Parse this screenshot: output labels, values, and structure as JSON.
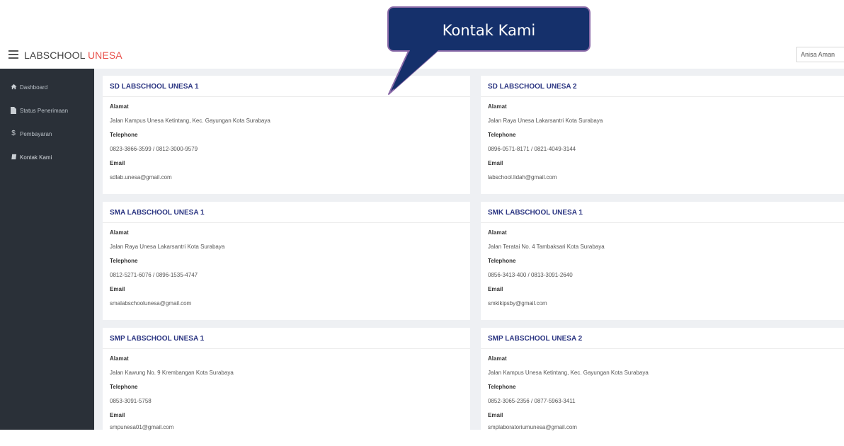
{
  "header": {
    "brand_main": "LABSCHOOL",
    "brand_accent": "UNESA",
    "user_name": "Anisa Aman"
  },
  "sidebar": {
    "items": [
      {
        "label": "Dashboard",
        "icon": "home-icon"
      },
      {
        "label": "Status Penerimaan",
        "icon": "file-icon"
      },
      {
        "label": "Pembayaran",
        "icon": "dollar-icon"
      },
      {
        "label": "Kontak Kami",
        "icon": "book-icon"
      }
    ]
  },
  "callout": {
    "text": "Kontak Kami"
  },
  "labels": {
    "address": "Alamat",
    "phone": "Telephone",
    "email": "Email"
  },
  "schools": [
    {
      "name": "SD LABSCHOOL UNESA 1",
      "address": "Jalan Kampus Unesa Ketintang, Kec. Gayungan Kota Surabaya",
      "phone": "0823-3866-3599 / 0812-3000-9579",
      "email": "sdlab.unesa@gmail.com"
    },
    {
      "name": "SD LABSCHOOL UNESA 2",
      "address": "Jalan Raya Unesa Lakarsantri Kota Surabaya",
      "phone": "0896-0571-8171 / 0821-4049-3144",
      "email": "labschool.lidah@gmail.com"
    },
    {
      "name": "SMA LABSCHOOL UNESA 1",
      "address": "Jalan Raya Unesa Lakarsantri Kota Surabaya",
      "phone": "0812-5271-6076 / 0896-1535-4747",
      "email": "smalabschoolunesa@gmail.com"
    },
    {
      "name": "SMK LABSCHOOL UNESA 1",
      "address": "Jalan Teratai No. 4 Tambaksari Kota Surabaya",
      "phone": "0856-3413-400 / 0813-3091-2640",
      "email": "smkikipsby@gmail.com"
    },
    {
      "name": "SMP LABSCHOOL UNESA 1",
      "address": "Jalan Kawung No. 9 Krembangan Kota Surabaya",
      "phone": "0853-3091-5758",
      "email": "smpunesa01@gmail.com"
    },
    {
      "name": "SMP LABSCHOOL UNESA 2",
      "address": "Jalan Kampus Unesa Ketintang, Kec. Gayungan Kota Surabaya",
      "phone": "0852-3065-2356 / 0877-5963-3411",
      "email": "smplaboratoriumunesa@gmail.com"
    }
  ],
  "colors": {
    "sidebar_bg": "#2a3038",
    "content_bg": "#eef0f3",
    "card_title": "#2b3582",
    "brand_accent": "#e8504a",
    "callout_bg": "#15306b",
    "callout_border": "#8a6aa8"
  }
}
